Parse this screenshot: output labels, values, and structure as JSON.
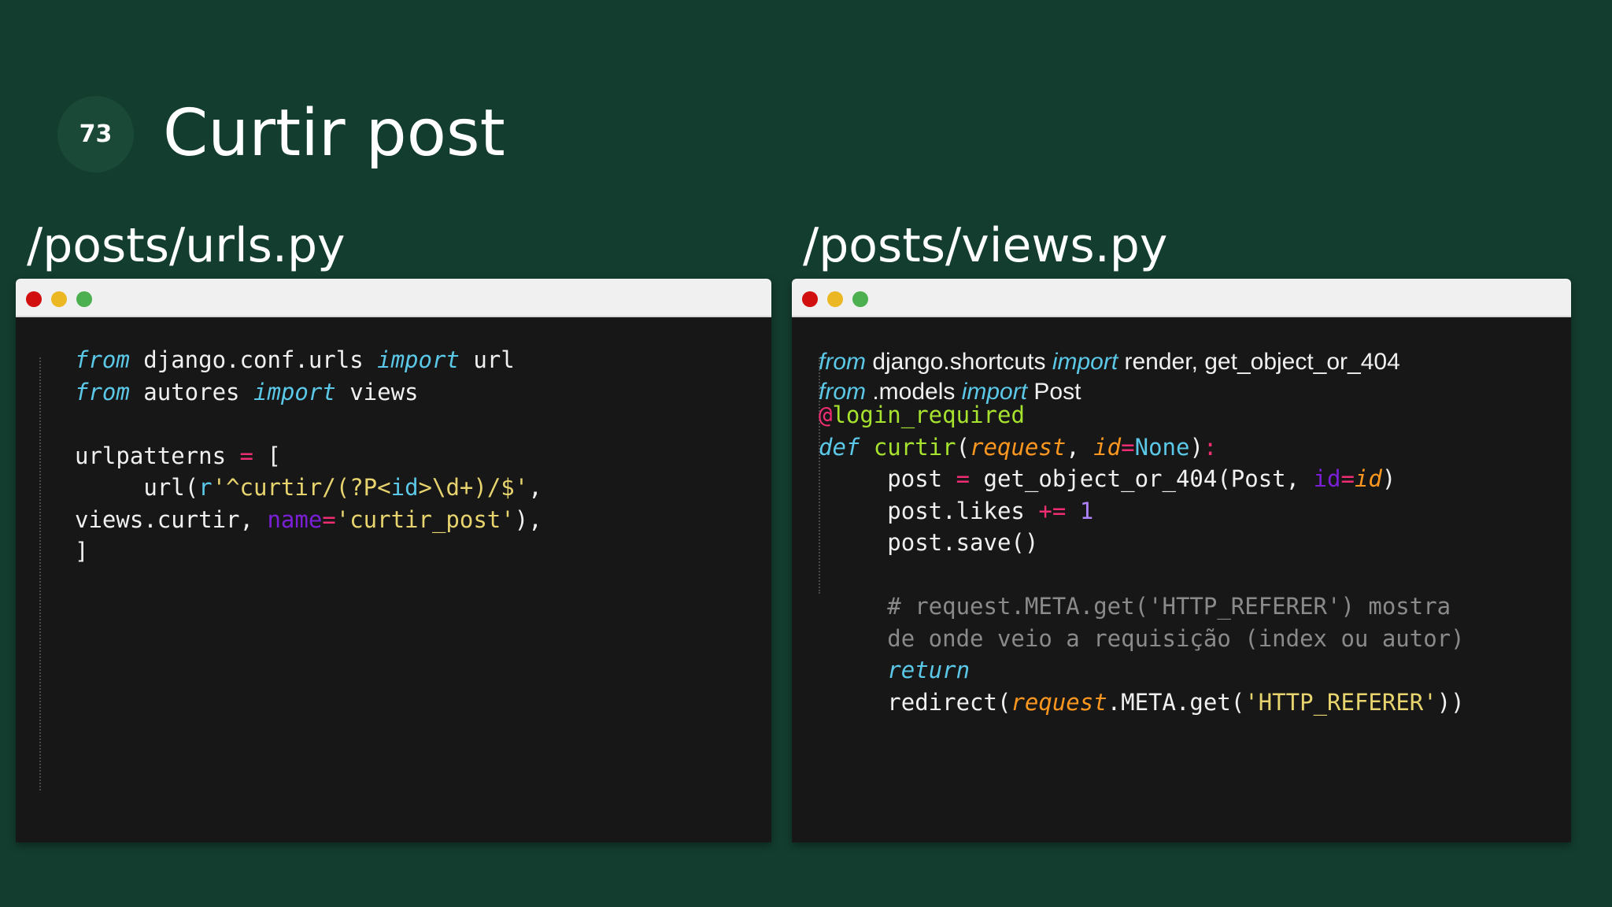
{
  "slide": {
    "number": "73",
    "title": "Curtir post"
  },
  "left_panel": {
    "file_title": "/posts/urls.py",
    "code": {
      "l1": {
        "from": "from",
        "mod": " django.conf.urls ",
        "import": "import",
        "name": " url"
      },
      "l2": {
        "from": "from",
        "mod": " autores ",
        "import": "import",
        "name": " views"
      },
      "l3": {
        "name": "urlpatterns ",
        "eq": "=",
        "bracket": " ["
      },
      "l4": {
        "indent": "     ",
        "call": "url(",
        "prefix": "r",
        "pat1": "'^curtir/(?P<",
        "group": "id",
        "pat2": ">\\d+)/$'",
        "comma": ","
      },
      "l5": {
        "views": "views.curtir, ",
        "kw": "name",
        "eq": "=",
        "str": "'curtir_post'",
        "close": "),"
      },
      "l6": {
        "text": "]"
      }
    }
  },
  "right_panel": {
    "file_title": "/posts/views.py",
    "imports": {
      "l1": {
        "from": "from",
        "mod": " django.shortcuts ",
        "import": "import",
        "names": " render, get_object_or_404"
      },
      "l2": {
        "from": "from",
        "mod": " .models ",
        "import": "import",
        "names": " Post"
      }
    },
    "code": {
      "decorator_at": "@",
      "decorator_name": "login_required",
      "def_kw": "def",
      "fn_name": " curtir",
      "open_paren": "(",
      "param1": "request",
      "sep": ", ",
      "param2": "id",
      "eq": "=",
      "none": "None",
      "close": ")",
      "colon": ":",
      "l3_a": "     post ",
      "l3_eq": "=",
      "l3_b": " get_object_or_404(Post, ",
      "l3_kw": "id",
      "l3_eq2": "=",
      "l3_val": "id",
      "l3_close": ")",
      "l4_a": "     post.likes ",
      "l4_op": "+=",
      "l4_sp": " ",
      "l4_num": "1",
      "l5": "     post.save()",
      "comment1": "     # request.META.get('HTTP_REFERER') mostra",
      "comment2": "     de onde veio a requisição (index ou autor)",
      "return_indent": "     ",
      "return_kw": "return",
      "l9_a": "     redirect(",
      "l9_param": "request",
      "l9_b": ".META.get(",
      "l9_str": "'HTTP_REFERER'",
      "l9_close": "))"
    }
  },
  "colors": {
    "background": "#133d2e",
    "badge": "#1a4a37",
    "editor_bg": "#171717",
    "keyword": "#5bc8e8",
    "operator": "#ef2d72",
    "string": "#e8d46e",
    "number": "#ae81ff",
    "kwarg": "#7a1fd6",
    "decorator": "#a6e22e",
    "param": "#fd971f",
    "comment": "#8a8a8a",
    "dot_red": "#d20f0f",
    "dot_yellow": "#ebb823",
    "dot_green": "#4caf50"
  }
}
